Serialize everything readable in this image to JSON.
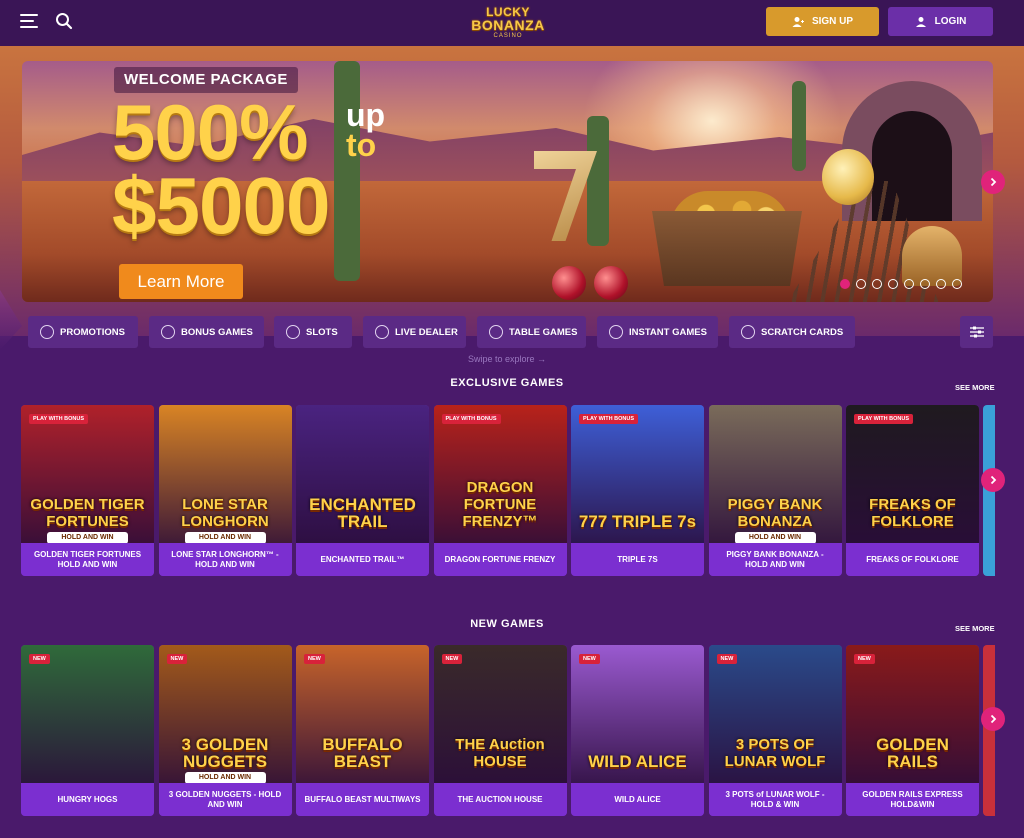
{
  "header": {
    "menu_icon": "hamburger-icon",
    "search_icon": "search-icon",
    "logo": {
      "line1": "LUCKY",
      "line2": "BONANZA",
      "line3": "CASINO"
    },
    "signup_label": "SIGN UP",
    "signup_icon": "user-plus-icon",
    "login_label": "LOGIN",
    "login_icon": "user-icon"
  },
  "hero": {
    "tag": "WELCOME PACKAGE",
    "percent": "500%",
    "up": "up",
    "to": "to",
    "amount": "$5000",
    "cta": "Learn More",
    "slide_count": 8,
    "active_slide": 1
  },
  "categories": [
    {
      "label": "PROMOTIONS",
      "icon": "promotions-icon"
    },
    {
      "label": "BONUS GAMES",
      "icon": "star-icon"
    },
    {
      "label": "SLOTS",
      "icon": "cherries-icon"
    },
    {
      "label": "LIVE DEALER",
      "icon": "live-dealer-icon"
    },
    {
      "label": "TABLE GAMES",
      "icon": "cards-icon"
    },
    {
      "label": "INSTANT GAMES",
      "icon": "instant-icon"
    },
    {
      "label": "SCRATCH CARDS",
      "icon": "scratch-icon"
    }
  ],
  "filter_icon": "sliders-icon",
  "swipe_hint": "Swipe to explore →",
  "exclusive": {
    "title": "EXCLUSIVE GAMES",
    "see_more": "SEE MORE",
    "games": [
      {
        "name": "GOLDEN TIGER FORTUNES HOLD AND WIN",
        "art_title": "GOLDEN TIGER FORTUNES",
        "art_sub": "HOLD AND WIN",
        "badge": "PLAY WITH BONUS",
        "color": "#b0212a"
      },
      {
        "name": "LONE STAR LONGHORN™ - HOLD AND WIN",
        "art_title": "LONE STAR LONGHORN",
        "art_sub": "HOLD AND WIN",
        "badge": "",
        "color": "#d98424"
      },
      {
        "name": "ENCHANTED TRAIL™",
        "art_title": "ENCHANTED TRAIL",
        "art_sub": "",
        "badge": "",
        "color": "#4a2380"
      },
      {
        "name": "DRAGON FORTUNE FRENZY",
        "art_title": "DRAGON FORTUNE FRENZY™",
        "art_sub": "",
        "badge": "PLAY WITH BONUS",
        "color": "#b8221a"
      },
      {
        "name": "TRIPLE 7S",
        "art_title": "777 TRIPLE 7s",
        "art_sub": "",
        "badge": "PLAY WITH BONUS",
        "color": "#3e5fd8"
      },
      {
        "name": "PIGGY BANK BONANZA - HOLD AND WIN",
        "art_title": "PIGGY BANK BONANZA",
        "art_sub": "HOLD AND WIN",
        "badge": "",
        "color": "#7a6b5a"
      },
      {
        "name": "FREAKS OF FOLKLORE",
        "art_title": "FREAKS OF FOLKLORE",
        "art_sub": "",
        "badge": "PLAY WITH BONUS",
        "color": "#1f1a1f"
      }
    ]
  },
  "new_games": {
    "title": "NEW GAMES",
    "see_more": "SEE MORE",
    "games": [
      {
        "name": "HUNGRY HOGS",
        "art_title": "",
        "art_sub": "",
        "badge": "NEW",
        "color": "#2f6a3a"
      },
      {
        "name": "3 GOLDEN NUGGETS - HOLD AND WIN",
        "art_title": "3 GOLDEN NUGGETS",
        "art_sub": "HOLD AND WIN",
        "badge": "NEW",
        "color": "#a35a1a"
      },
      {
        "name": "BUFFALO BEAST MULTIWAYS",
        "art_title": "BUFFALO BEAST",
        "art_sub": "",
        "badge": "NEW",
        "color": "#c8642a"
      },
      {
        "name": "THE AUCTION HOUSE",
        "art_title": "THE Auction HOUSE",
        "art_sub": "",
        "badge": "NEW",
        "color": "#3a2a2a"
      },
      {
        "name": "WILD ALICE",
        "art_title": "WILD ALICE",
        "art_sub": "",
        "badge": "NEW",
        "color": "#9a5ad0"
      },
      {
        "name": "3 POTS of LUNAR WOLF - HOLD & WIN",
        "art_title": "3 POTS OF LUNAR WOLF",
        "art_sub": "",
        "badge": "NEW",
        "color": "#2a4a8a"
      },
      {
        "name": "GOLDEN RAILS EXPRESS HOLD&WIN",
        "art_title": "GOLDEN RAILS",
        "art_sub": "",
        "badge": "NEW",
        "color": "#8a1a1a"
      }
    ]
  },
  "colors": {
    "background": "#4a1a6b",
    "header": "#3a1556",
    "signup": "#d89a2c",
    "login": "#6b2fa8",
    "accent_pink": "#e0237a",
    "cta_orange": "#f08a1c",
    "gold_text": "#ffd24a"
  }
}
